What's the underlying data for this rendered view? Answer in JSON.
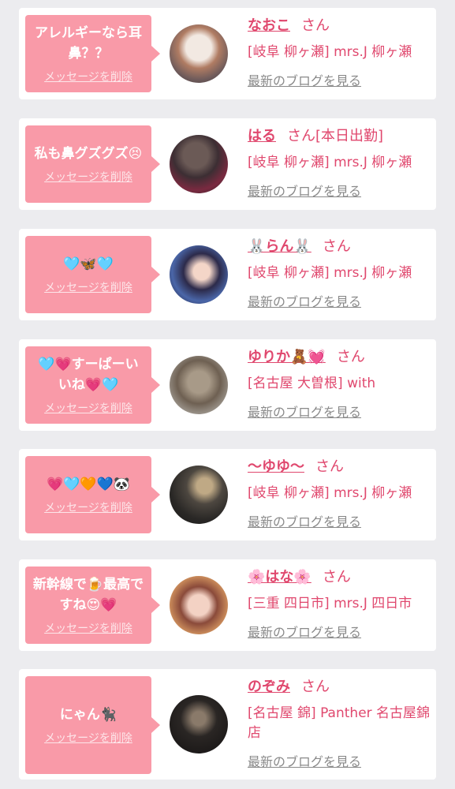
{
  "common": {
    "delete_label": "メッセージを削除",
    "honorific": "さん",
    "blog_link": "最新のブログを見る"
  },
  "cards": [
    {
      "message": "アレルギーなら耳鼻？？",
      "name": "なおこ",
      "status": "",
      "shop": "[岐阜 柳ヶ瀬] mrs.J 柳ヶ瀬"
    },
    {
      "message": "私も鼻グズグズ😣",
      "name": "はる",
      "status": "[本日出勤]",
      "shop": "[岐阜 柳ヶ瀬] mrs.J 柳ヶ瀬"
    },
    {
      "message": "🩵🦋🩵",
      "name": "🐰らん🐰",
      "status": "",
      "shop": "[岐阜 柳ヶ瀬] mrs.J 柳ヶ瀬"
    },
    {
      "message": "🩵💗すーぱーいいね💗🩵",
      "name": "ゆりか🧸💓",
      "status": "",
      "shop": "[名古屋 大曽根] with"
    },
    {
      "message": "💗🩵🧡💙🐼",
      "name": "〜ゆゆ〜",
      "status": "",
      "shop": "[岐阜 柳ヶ瀬] mrs.J 柳ヶ瀬"
    },
    {
      "message": "新幹線で🍺最高ですね😍💗",
      "name": "🌸はな🌸",
      "status": "",
      "shop": "[三重 四日市] mrs.J 四日市"
    },
    {
      "message": "にゃん🐈‍⬛",
      "name": "のぞみ",
      "status": "",
      "shop": "[名古屋 錦] Panther 名古屋錦店"
    }
  ]
}
